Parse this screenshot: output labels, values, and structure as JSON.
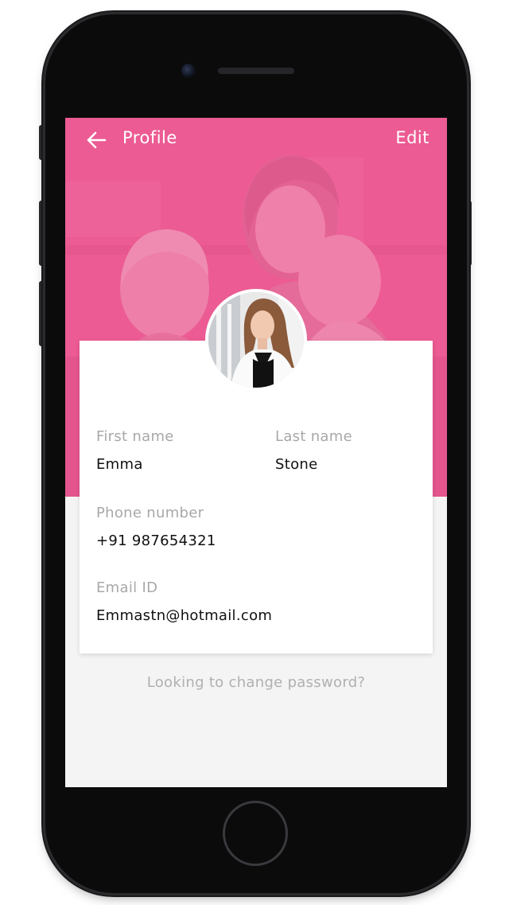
{
  "header": {
    "title": "Profile",
    "edit_label": "Edit",
    "back_icon": "arrow-left-icon"
  },
  "theme": {
    "accent": "#ec5b93",
    "label_color": "#a8a8a8",
    "value_color": "#111111",
    "background": "#f4f4f4"
  },
  "profile": {
    "first_name": {
      "label": "First name",
      "value": "Emma"
    },
    "last_name": {
      "label": "Last name",
      "value": "Stone"
    },
    "phone": {
      "label": "Phone number",
      "value": "+91 987654321"
    },
    "email": {
      "label": "Email ID",
      "value": "Emmastn@hotmail.com"
    }
  },
  "footer": {
    "change_password": "Looking to change password?"
  }
}
